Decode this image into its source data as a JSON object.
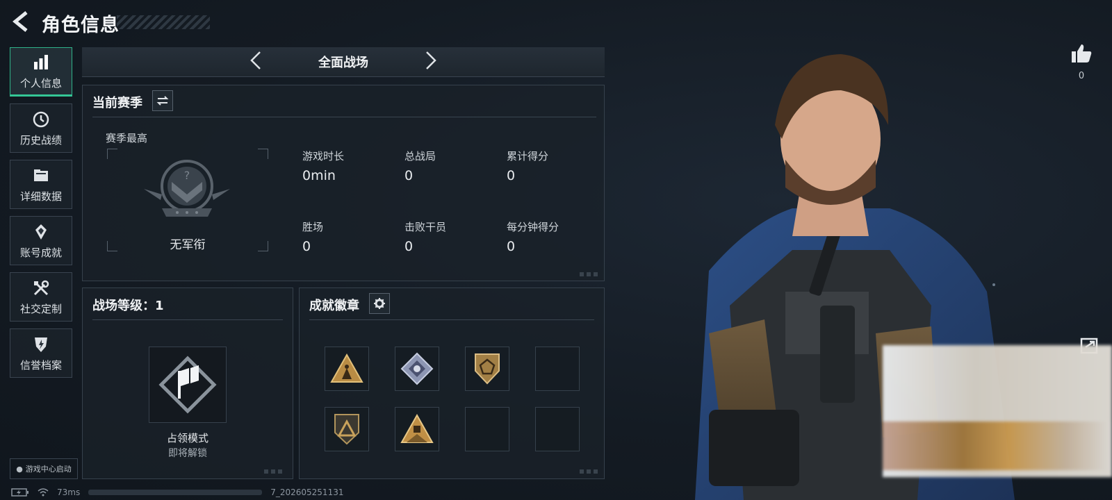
{
  "header": {
    "title": "角色信息"
  },
  "nav": {
    "items": [
      {
        "label": "个人信息",
        "icon": "bar-chart-icon"
      },
      {
        "label": "历史战绩",
        "icon": "history-clock-icon"
      },
      {
        "label": "详细数据",
        "icon": "folder-icon"
      },
      {
        "label": "账号成就",
        "icon": "achievement-icon"
      },
      {
        "label": "社交定制",
        "icon": "tools-icon"
      },
      {
        "label": "信誉档案",
        "icon": "shield-bolt-icon"
      }
    ],
    "active_index": 0,
    "game_center": "游戏中心启动"
  },
  "mode": {
    "title": "全面战场"
  },
  "season": {
    "title": "当前赛季",
    "best_label": "赛季最高",
    "rank_name": "无军衔",
    "stats": [
      {
        "label": "游戏时长",
        "value": "0min"
      },
      {
        "label": "总战局",
        "value": "0"
      },
      {
        "label": "累计得分",
        "value": "0"
      },
      {
        "label": "胜场",
        "value": "0"
      },
      {
        "label": "击败干员",
        "value": "0"
      },
      {
        "label": "每分钟得分",
        "value": "0"
      }
    ]
  },
  "level": {
    "title": "战场等级：1",
    "mode_name": "占领模式",
    "mode_status": "即将解锁"
  },
  "badges": {
    "title": "成就徽章",
    "slots": [
      {
        "icon": "gold-triangle-badge-icon"
      },
      {
        "icon": "silver-diamond-badge-icon"
      },
      {
        "icon": "gold-shield-badge-icon"
      },
      {
        "icon": ""
      },
      {
        "icon": "dark-shield-badge-icon"
      },
      {
        "icon": "gold-pyramid-badge-icon"
      },
      {
        "icon": ""
      },
      {
        "icon": ""
      }
    ]
  },
  "profile": {
    "likes": "0"
  },
  "status": {
    "ping": "73ms",
    "build": "7_202605251131"
  },
  "colors": {
    "accent": "#34c796",
    "gold": "#c9a25b",
    "panel_border": "#36414c"
  }
}
